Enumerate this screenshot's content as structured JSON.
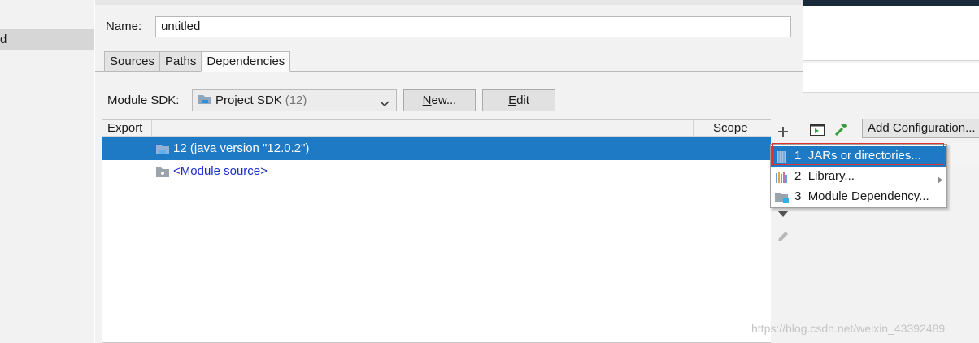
{
  "sidebar": {
    "selected_item_partial": "d"
  },
  "name_field": {
    "label": "Name:",
    "value": "untitled"
  },
  "tabs": [
    {
      "label": "Sources"
    },
    {
      "label": "Paths"
    },
    {
      "label": "Dependencies",
      "active": true
    }
  ],
  "module_sdk": {
    "label": "Module SDK:",
    "value": "Project SDK",
    "value_suffix": "(12)",
    "new_button": "New...",
    "edit_button": "Edit"
  },
  "dependencies_table": {
    "headers": {
      "export": "Export",
      "scope": "Scope"
    },
    "rows": [
      {
        "label": "12 (java version \"12.0.2\")",
        "selected": true
      },
      {
        "label": "<Module source>",
        "selected": false
      }
    ]
  },
  "background_window": {
    "add_configuration_label": "Add Configuration..."
  },
  "popup_menu": {
    "items": [
      {
        "number": "1",
        "label": "JARs or directories...",
        "highlighted": true
      },
      {
        "number": "2",
        "label": "Library...",
        "has_submenu": true
      },
      {
        "number": "3",
        "label": "Module Dependency..."
      }
    ]
  },
  "watermark": "https://blog.csdn.net/weixin_43392489",
  "colors": {
    "selection": "#1f7ac6",
    "link": "#1b2ecc",
    "callout_red": "#e03030",
    "panel_bg": "#f2f2f2"
  }
}
